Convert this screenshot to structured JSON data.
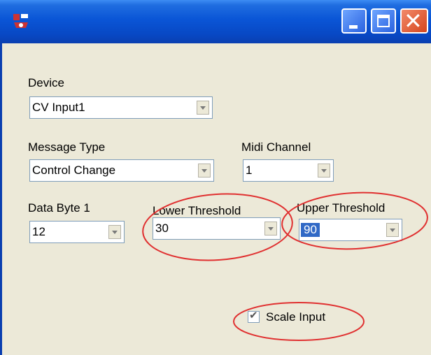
{
  "window": {
    "title_icon": "app-icon",
    "controls": [
      "minimize-icon",
      "maximize-icon",
      "close-icon"
    ],
    "accent_color": "#0a55d6",
    "close_color": "#d6461e"
  },
  "device": {
    "label": "Device",
    "value": "CV Input1"
  },
  "message_type": {
    "label": "Message Type",
    "value": "Control Change"
  },
  "midi_channel": {
    "label": "Midi Channel",
    "value": "1"
  },
  "data_byte_1": {
    "label": "Data Byte 1",
    "value": "12"
  },
  "lower_threshold": {
    "label": "Lower Threshold",
    "value": "30"
  },
  "upper_threshold": {
    "label": "Upper Threshold",
    "value": "90"
  },
  "scale_input": {
    "label": "Scale Input",
    "checked": true
  },
  "annotation_color": "#e03030"
}
